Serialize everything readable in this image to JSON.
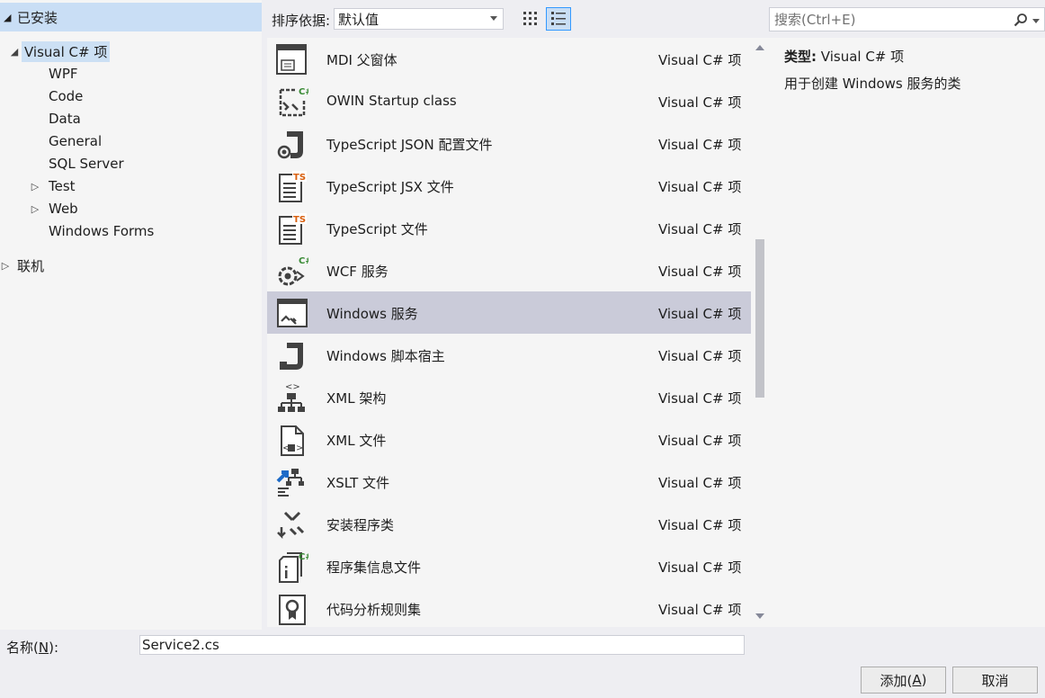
{
  "tree": {
    "header": "已安装",
    "root": "Visual C# 项",
    "children": [
      "WPF",
      "Code",
      "Data",
      "General",
      "SQL Server",
      "Test",
      "Web",
      "Windows Forms"
    ],
    "online": "联机"
  },
  "toolbar": {
    "sort_label": "排序依据:",
    "sort_value": "默认值"
  },
  "search": {
    "placeholder": "搜索(Ctrl+E)"
  },
  "templates": [
    {
      "name": "MDI 父窗体",
      "type": "Visual C# 项",
      "icon": "mdi-form-icon"
    },
    {
      "name": "OWIN Startup class",
      "type": "Visual C# 项",
      "icon": "owin-startup-icon"
    },
    {
      "name": "TypeScript JSON 配置文件",
      "type": "Visual C# 项",
      "icon": "typescript-json-icon"
    },
    {
      "name": "TypeScript JSX 文件",
      "type": "Visual C# 项",
      "icon": "typescript-jsx-icon"
    },
    {
      "name": "TypeScript 文件",
      "type": "Visual C# 项",
      "icon": "typescript-file-icon"
    },
    {
      "name": "WCF 服务",
      "type": "Visual C# 项",
      "icon": "wcf-service-icon"
    },
    {
      "name": "Windows 服务",
      "type": "Visual C# 项",
      "icon": "windows-service-icon",
      "selected": true
    },
    {
      "name": "Windows 脚本宿主",
      "type": "Visual C# 项",
      "icon": "script-host-icon"
    },
    {
      "name": "XML 架构",
      "type": "Visual C# 项",
      "icon": "xml-schema-icon"
    },
    {
      "name": "XML 文件",
      "type": "Visual C# 项",
      "icon": "xml-file-icon"
    },
    {
      "name": "XSLT 文件",
      "type": "Visual C# 项",
      "icon": "xslt-file-icon"
    },
    {
      "name": "安装程序类",
      "type": "Visual C# 项",
      "icon": "installer-class-icon"
    },
    {
      "name": "程序集信息文件",
      "type": "Visual C# 项",
      "icon": "assembly-info-icon"
    },
    {
      "name": "代码分析规则集",
      "type": "Visual C# 项",
      "icon": "code-analysis-ruleset-icon"
    }
  ],
  "details": {
    "type_key": "类型:",
    "type_value": "Visual C# 项",
    "description": "用于创建 Windows 服务的类"
  },
  "bottom": {
    "name_label_pre": "名称(",
    "name_label_key": "N",
    "name_label_post": "):",
    "name_value": "Service2.cs",
    "add_pre": "添加(",
    "add_key": "A",
    "add_post": ")",
    "cancel": "取消"
  },
  "colors": {
    "accent": "#3399ff",
    "tree_header_bg": "#c9def5",
    "selected_row_bg": "#cacbd9",
    "csharp_green": "#388a34",
    "ts_orange": "#d95f0e",
    "xslt_blue": "#1e6bc7"
  }
}
